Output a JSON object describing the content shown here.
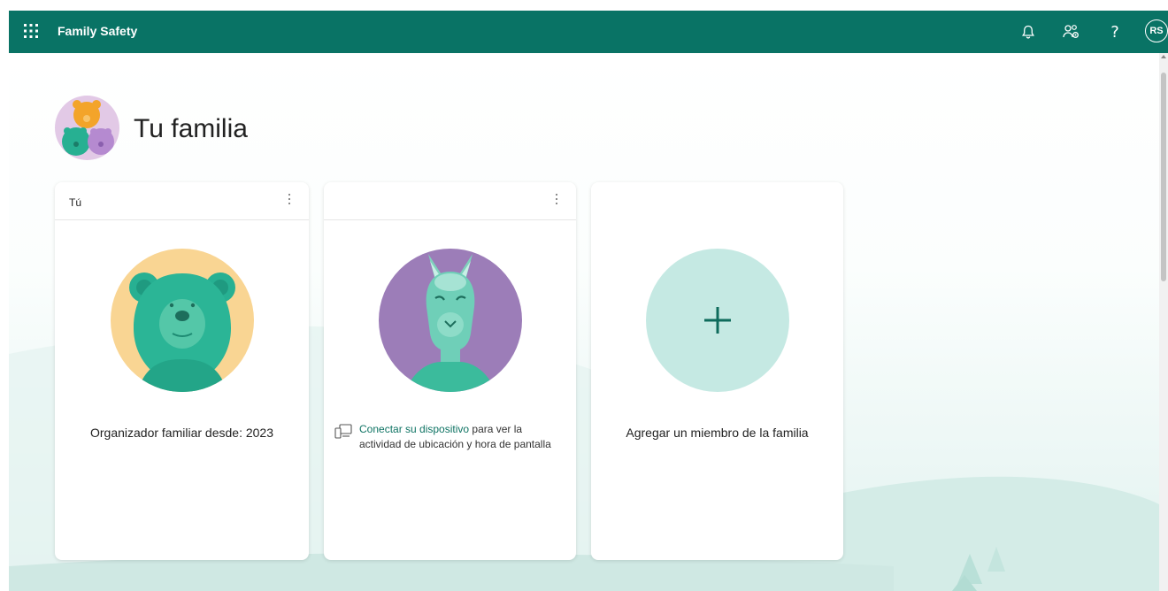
{
  "app": {
    "title": "Family Safety",
    "user_initials": "RS"
  },
  "page": {
    "title": "Tu familia"
  },
  "cards": [
    {
      "name": "Tú",
      "caption": "Organizador familiar desde: 2023"
    },
    {
      "name": "",
      "link_text": "Conectar su dispositivo",
      "rest_text": " para ver la actividad de ubicación y hora de pantalla"
    },
    {
      "caption": "Agregar un miembro de la familia"
    }
  ],
  "colors": {
    "brand": "#097365",
    "accent_teal": "#27b092",
    "bear_bg": "#f9d593",
    "llama_bg": "#9c7db8",
    "add_bg": "#c5e9e3"
  },
  "icons": [
    "waffle-icon",
    "bell-icon",
    "family-settings-icon",
    "help-icon",
    "more-options-icon",
    "device-icon",
    "plus-icon"
  ]
}
